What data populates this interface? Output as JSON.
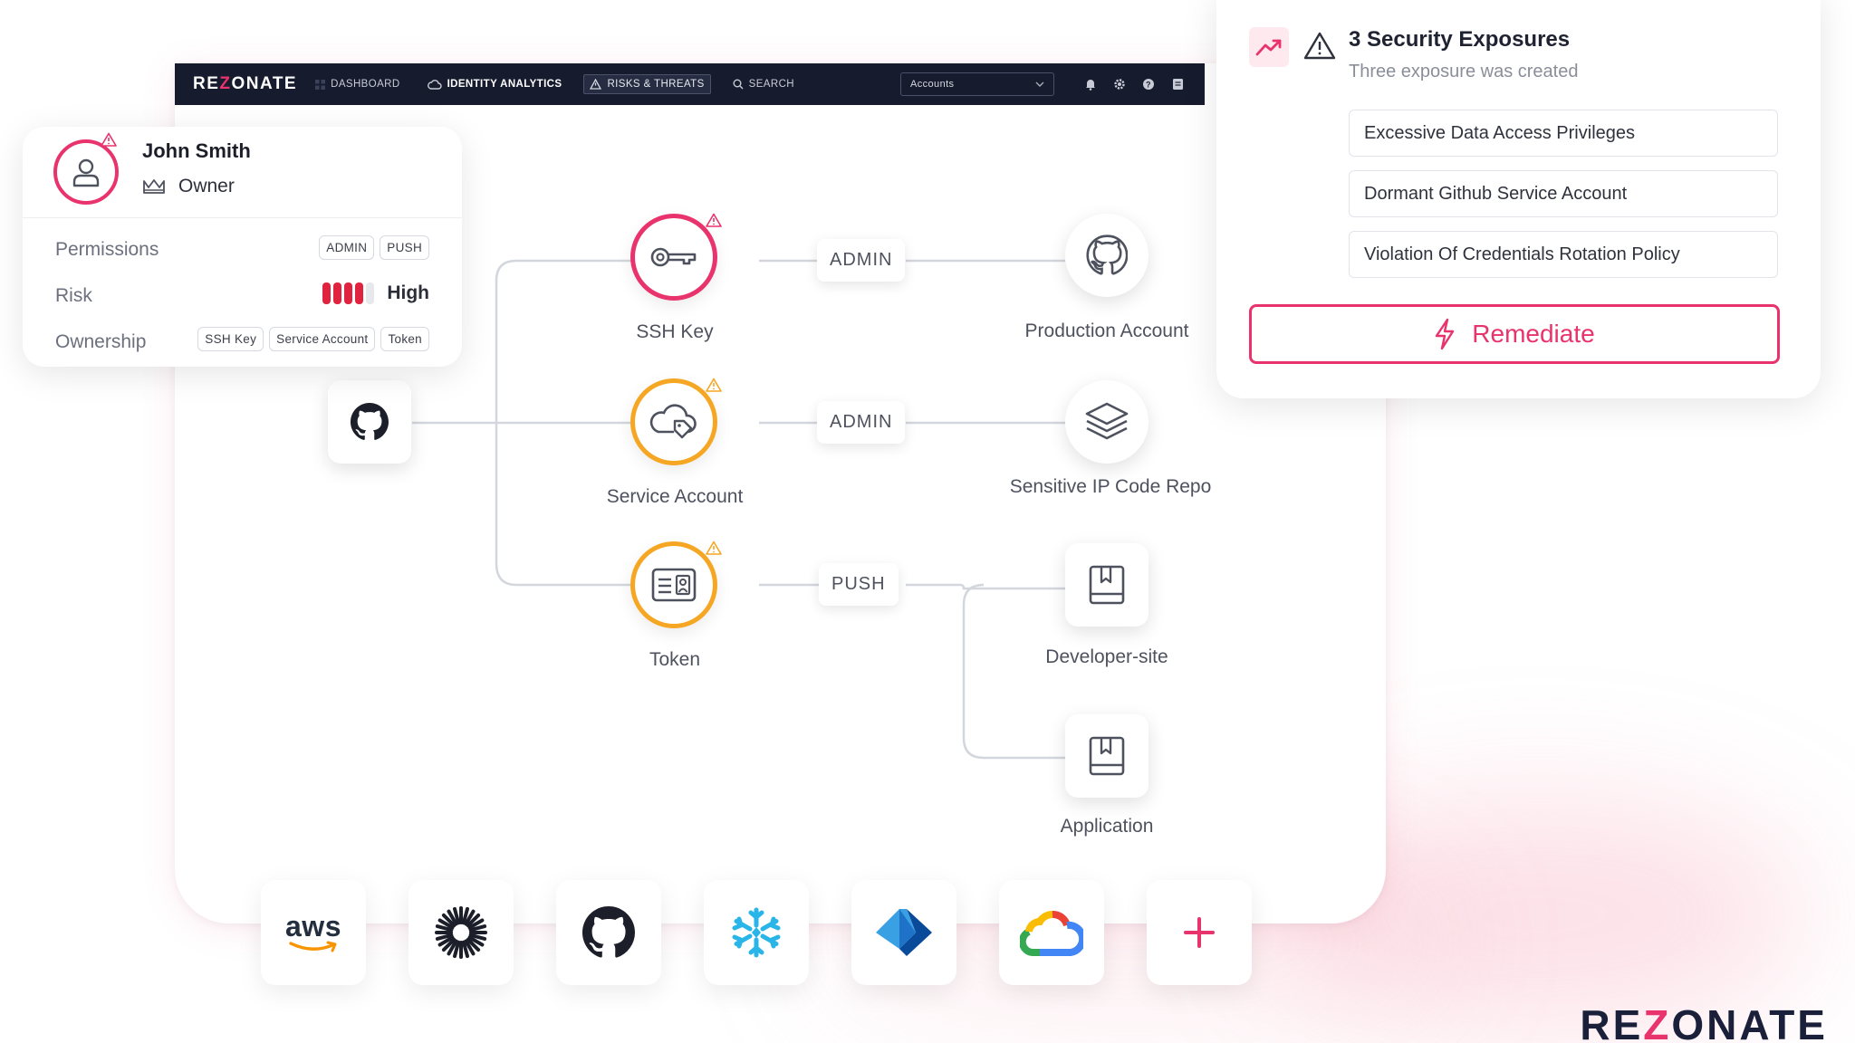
{
  "navbar": {
    "logo": {
      "pre": "RE",
      "z": "Z",
      "post": "ONATE"
    },
    "items": [
      {
        "label": "DASHBOARD"
      },
      {
        "label": "IDENTITY ANALYTICS"
      },
      {
        "label": "RISKS & THREATS"
      },
      {
        "label": "SEARCH"
      }
    ],
    "accounts_select": "Accounts"
  },
  "user_card": {
    "name": "John Smith",
    "role": "Owner",
    "permissions_label": "Permissions",
    "permissions": [
      "ADMIN",
      "PUSH"
    ],
    "risk_label": "Risk",
    "risk_level": "High",
    "risk_score": {
      "filled": 4,
      "total": 5
    },
    "ownership_label": "Ownership",
    "ownership": [
      "SSH Key",
      "Service Account",
      "Token"
    ]
  },
  "graph": {
    "source_icon": "github-icon",
    "nodes": {
      "ssh_key": {
        "label": "SSH Key",
        "icon": "key-icon",
        "color": "#e8336d"
      },
      "service_account": {
        "label": "Service Account",
        "icon": "cloud-tag-icon",
        "color": "#f5a623"
      },
      "token": {
        "label": "Token",
        "icon": "id-card-icon",
        "color": "#f5a623"
      },
      "production_account": {
        "label": "Production Account",
        "icon": "github-icon"
      },
      "sensitive_ip": {
        "label": "Sensitive IP  Code Repo",
        "icon": "layers-icon"
      },
      "developer_site": {
        "label": "Developer-site",
        "icon": "book-icon"
      },
      "application": {
        "label": "Application",
        "icon": "book-icon"
      }
    },
    "edges": {
      "ssh": "ADMIN",
      "service": "ADMIN",
      "token": "PUSH"
    }
  },
  "exposure": {
    "title": "3 Security Exposures",
    "subtitle": "Three exposure was created",
    "items": [
      "Excessive Data Access Privileges",
      "Dormant Github Service Account",
      "Violation Of Credentials Rotation Policy"
    ],
    "button": "Remediate"
  },
  "integrations": {
    "aws": "aws",
    "tiles": [
      "aws-icon",
      "sun-burst-icon",
      "github-icon",
      "snowflake-icon",
      "azure-icon",
      "google-cloud-icon",
      "plus-icon"
    ]
  },
  "brand": {
    "pre": "RE",
    "z": "Z",
    "post": "ONATE"
  },
  "colors": {
    "accent": "#e8336d",
    "warning": "#f5a623",
    "risk": "#e0243f",
    "navbar": "#161b2e"
  }
}
